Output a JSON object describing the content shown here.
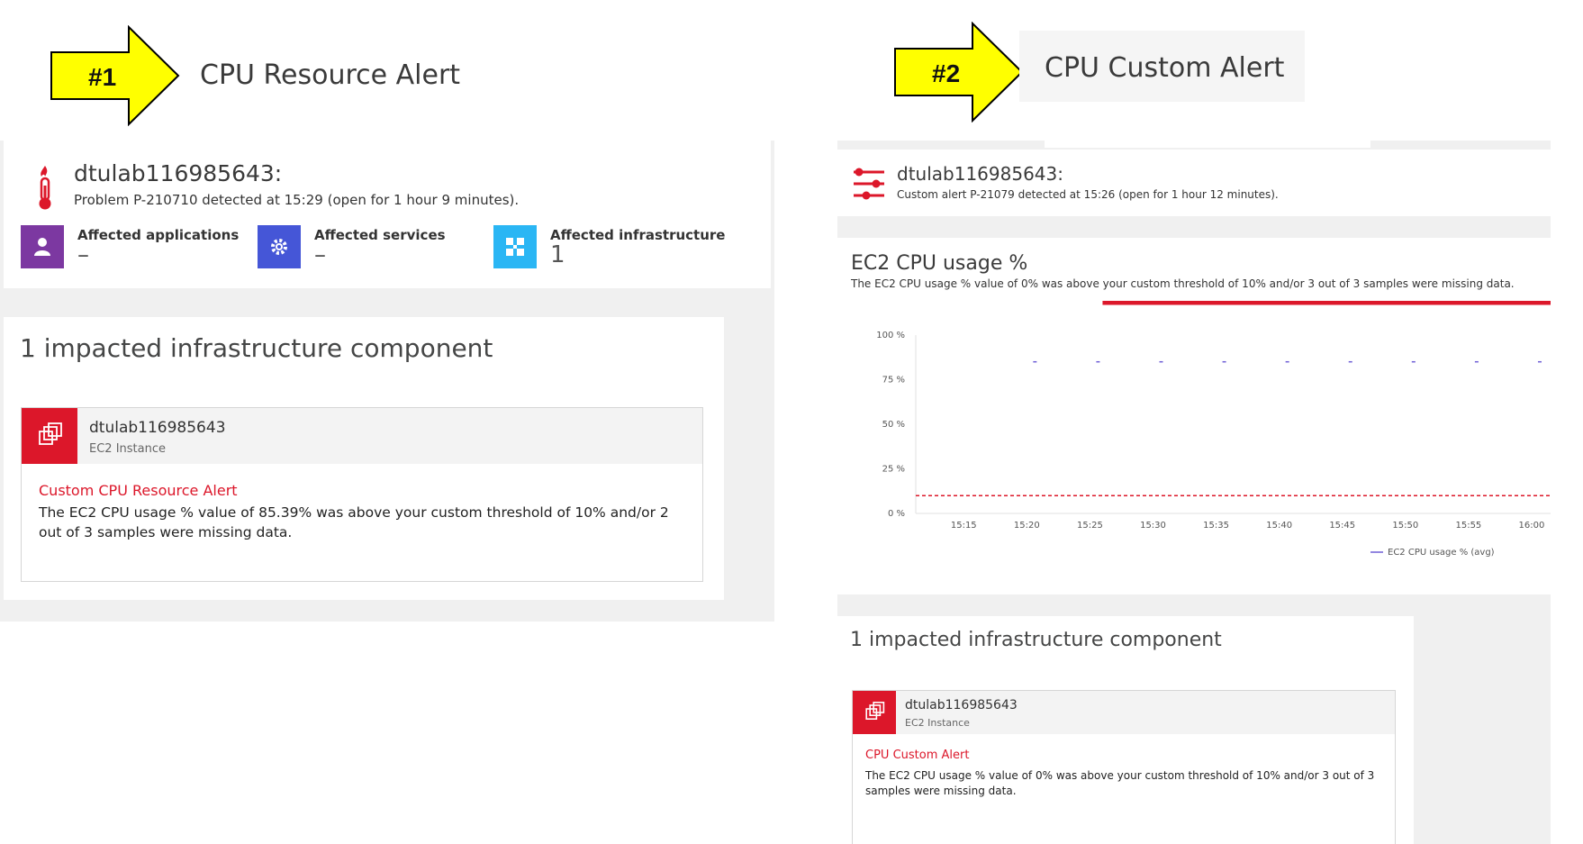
{
  "left": {
    "arrow_label": "#1",
    "title": "CPU Resource Alert",
    "host": "dtulab116985643:",
    "problem_line": "Problem P-210710 detected at 15:29 (open for 1 hour 9 minutes).",
    "affected": [
      {
        "label": "Affected applications",
        "value": "–",
        "icon": "user-icon",
        "color": "#7c38a1"
      },
      {
        "label": "Affected services",
        "value": "–",
        "icon": "gear-icon",
        "color": "#4556d7"
      },
      {
        "label": "Affected infrastructure",
        "value": "1",
        "icon": "infrastructure-icon",
        "color": "#2ab6f4"
      }
    ],
    "impact_title": "1 impacted infrastructure component",
    "component": {
      "name": "dtulab116985643",
      "type": "EC2 Instance",
      "alert": "Custom CPU Resource Alert",
      "description": "The EC2 CPU usage % value of 85.39% was above your custom threshold of 10% and/or 2 out of 3 samples were missing data."
    }
  },
  "right": {
    "arrow_label": "#2",
    "title": "CPU Custom Alert",
    "host": "dtulab116985643:",
    "alert_line": "Custom alert P-21079 detected at 15:26 (open for 1 hour 12 minutes).",
    "chart_title": "EC2 CPU usage %",
    "chart_subtitle": "The EC2 CPU usage % value of 0% was above your custom threshold of 10% and/or 3 out of 3 samples were missing data.",
    "impact_title": "1 impacted infrastructure component",
    "component": {
      "name": "dtulab116985643",
      "type": "EC2 Instance",
      "alert": "CPU Custom Alert",
      "description": "The EC2 CPU usage % value of 0% was above your custom threshold of 10% and/or 3 out of 3 samples were missing data."
    }
  },
  "colors": {
    "accent_red": "#dc172a",
    "arrow_yellow": "#ffff00",
    "series_purple": "#6f5fd6"
  },
  "chart_data": {
    "type": "line",
    "title": "EC2 CPU usage %",
    "x": [
      "15:15",
      "15:20",
      "15:25",
      "15:30",
      "15:35",
      "15:40",
      "15:45",
      "15:50",
      "15:55",
      "16:00"
    ],
    "y_ticks": [
      "0 %",
      "25 %",
      "50 %",
      "75 %",
      "100 %"
    ],
    "ylim": [
      0,
      100
    ],
    "threshold": 10,
    "alert_band_start": "15:26",
    "series": [
      {
        "name": "EC2 CPU usage % (avg)",
        "x": [
          "15:20",
          "15:25",
          "15:30",
          "15:35",
          "15:40",
          "15:45",
          "15:50",
          "15:55",
          "16:00"
        ],
        "values": [
          85,
          85,
          85,
          85,
          85,
          85,
          85,
          85,
          85
        ]
      }
    ],
    "legend": "bottom-right"
  }
}
